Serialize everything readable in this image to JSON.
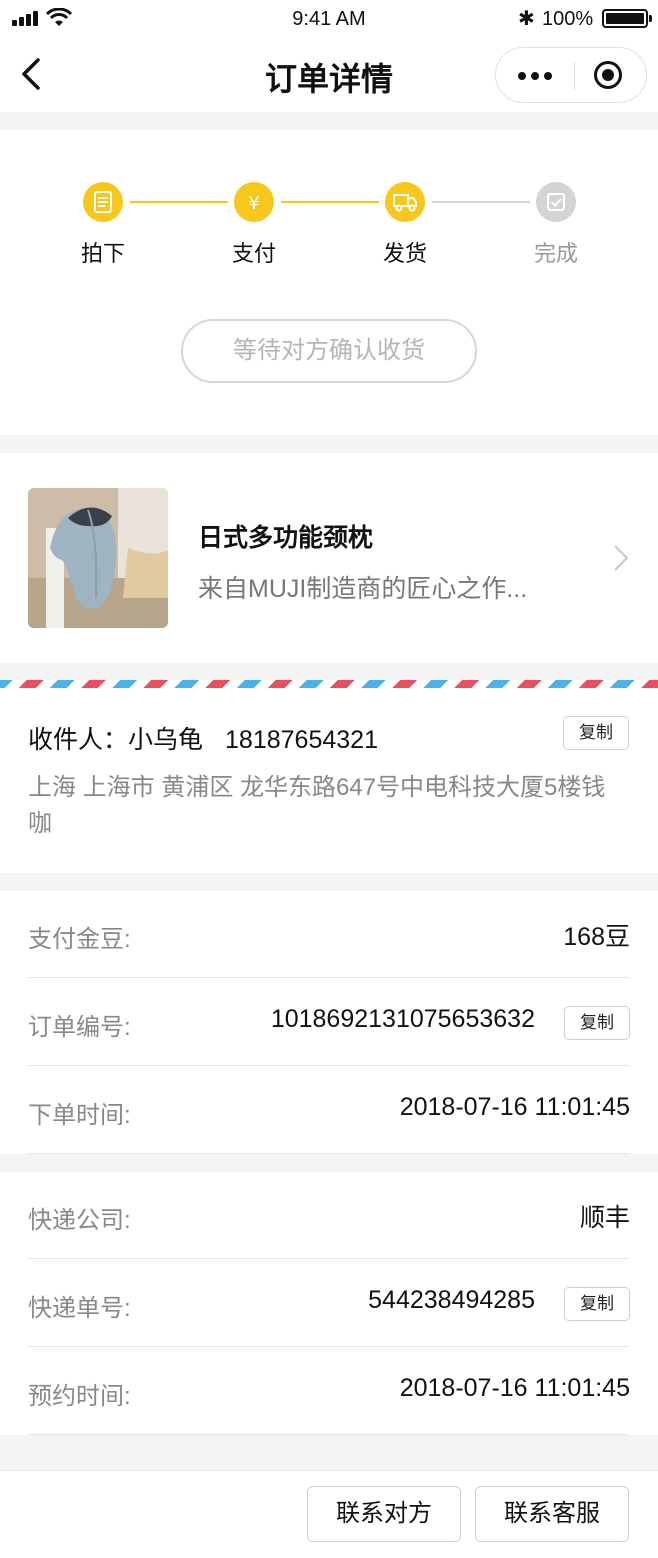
{
  "status_bar": {
    "time": "9:41 AM",
    "battery": "100%"
  },
  "nav": {
    "title": "订单详情"
  },
  "progress": {
    "steps": [
      {
        "label": "拍下",
        "icon": "list-icon",
        "done": true
      },
      {
        "label": "支付",
        "icon": "yen-icon",
        "done": true
      },
      {
        "label": "发货",
        "icon": "truck-icon",
        "done": true
      },
      {
        "label": "完成",
        "icon": "check-icon",
        "done": false
      }
    ],
    "status_text": "等待对方确认收货"
  },
  "product": {
    "name": "日式多功能颈枕",
    "desc": "来自MUJI制造商的匠心之作..."
  },
  "address": {
    "recipient_label": "收件人：",
    "name": "小乌龟",
    "phone": "18187654321",
    "copy_label": "复制",
    "full_address": "上海 上海市 黄浦区 龙华东路647号中电科技大厦5楼钱咖"
  },
  "order_info": {
    "pay_label": "支付金豆:",
    "pay_value": "168豆",
    "order_no_label": "订单编号:",
    "order_no_value": "1018692131075653632",
    "order_time_label": "下单时间:",
    "order_time_value": "2018-07-16 11:01:45",
    "copy_label": "复制"
  },
  "shipping_info": {
    "company_label": "快递公司:",
    "company_value": "顺丰",
    "tracking_label": "快递单号:",
    "tracking_value": "544238494285",
    "appointment_label": "预约时间:",
    "appointment_value": "2018-07-16 11:01:45",
    "copy_label": "复制"
  },
  "footer": {
    "contact_seller": "联系对方",
    "contact_service": "联系客服"
  },
  "colors": {
    "accent_yellow": "#f7c81b",
    "inactive_gray": "#cfcfcf",
    "airmail_red": "#e9505d",
    "airmail_blue": "#4ab2e6"
  }
}
